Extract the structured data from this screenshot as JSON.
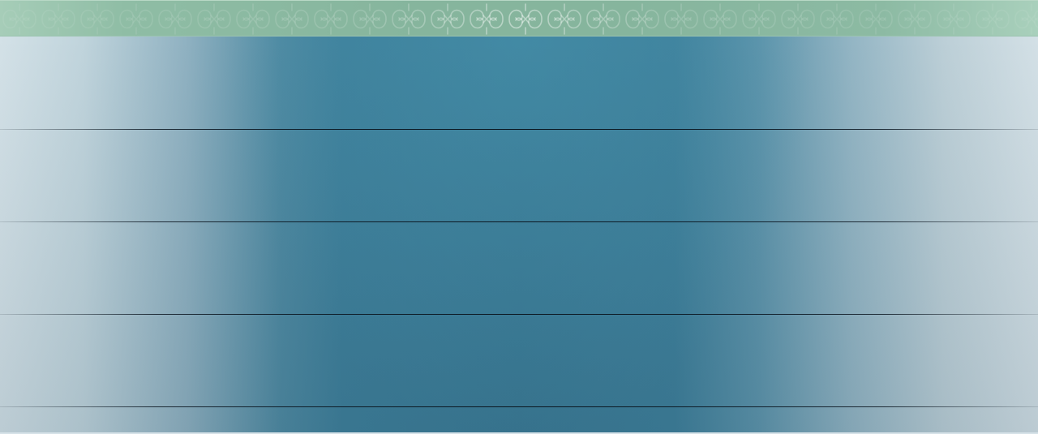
{
  "header": {
    "ornament_icon": "kazakh-ornament-pattern",
    "band_color": "#86b59d"
  },
  "main": {
    "rows": [
      {
        "label": ""
      },
      {
        "label": ""
      },
      {
        "label": ""
      },
      {
        "label": ""
      },
      {
        "label": ""
      }
    ],
    "colors": {
      "center": "#3b7b96",
      "edge": "#d3e1e7",
      "divider": "#0b1620"
    }
  }
}
